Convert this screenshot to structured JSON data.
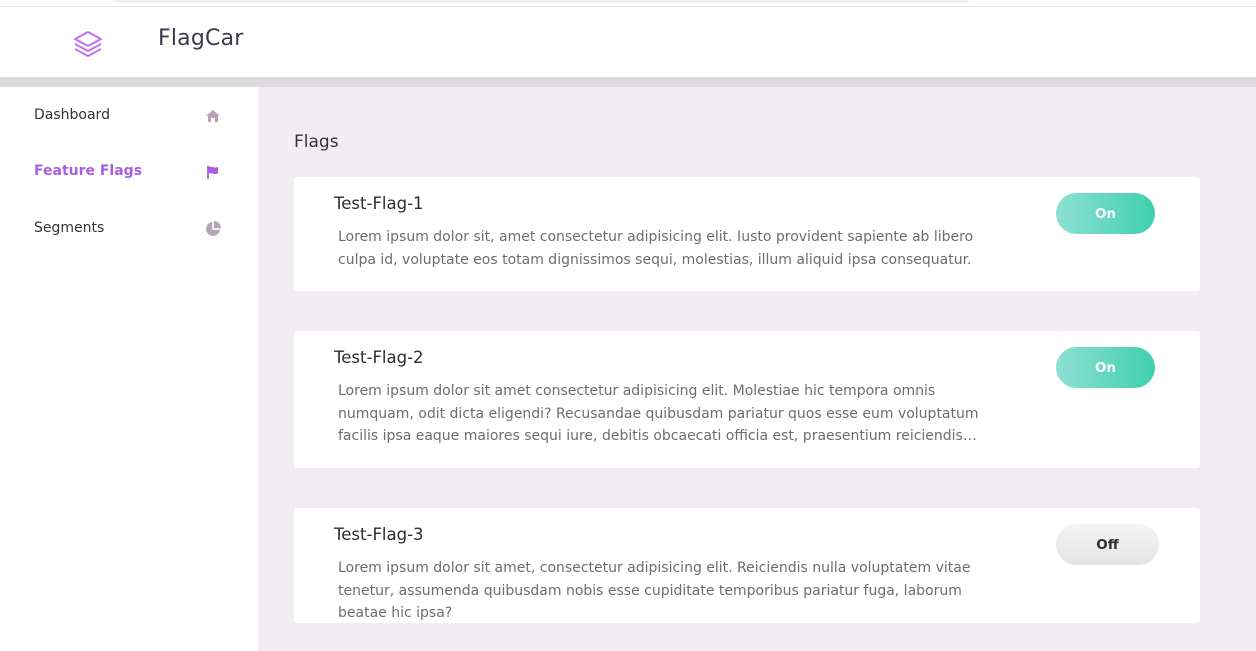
{
  "app": {
    "name": "FlagCar",
    "logo_icon": "layers-icon",
    "accent_color": "#a65fe0"
  },
  "sidebar": {
    "items": [
      {
        "label": "Dashboard",
        "icon": "home-icon",
        "active": false
      },
      {
        "label": "Feature Flags",
        "icon": "flag-icon",
        "active": true
      },
      {
        "label": "Segments",
        "icon": "pie-chart-icon",
        "active": false
      }
    ]
  },
  "main": {
    "title": "Flags",
    "flags": [
      {
        "name": "Test-Flag-1",
        "description": "Lorem ipsum dolor sit, amet consectetur adipisicing elit. Iusto provident sapiente ab libero culpa id, voluptate eos totam dignissimos sequi, molestias, illum aliquid ipsa consequatur.",
        "status": "On"
      },
      {
        "name": "Test-Flag-2",
        "description": "Lorem ipsum dolor sit amet consectetur adipisicing elit. Molestiae hic tempora omnis numquam, odit dicta eligendi? Recusandae quibusdam pariatur quos esse eum voluptatum facilis ipsa eaque maiores sequi iure, debitis obcaecati officia est, praesentium reiciendis assumenda vero tempore…",
        "status": "On"
      },
      {
        "name": "Test-Flag-3",
        "description": "Lorem ipsum dolor sit amet, consectetur adipisicing elit. Reiciendis nulla voluptatem vitae tenetur, assumenda quibusdam nobis esse cupiditate temporibus pariatur fuga, laborum beatae hic ipsa?",
        "status": "Off"
      }
    ]
  },
  "colors": {
    "toggle_on_start": "#8ee0d3",
    "toggle_on_end": "#3fcfae",
    "toggle_off": "#e8e8e8",
    "main_bg": "#f2edf2",
    "icon_muted": "#b8a2b8"
  }
}
